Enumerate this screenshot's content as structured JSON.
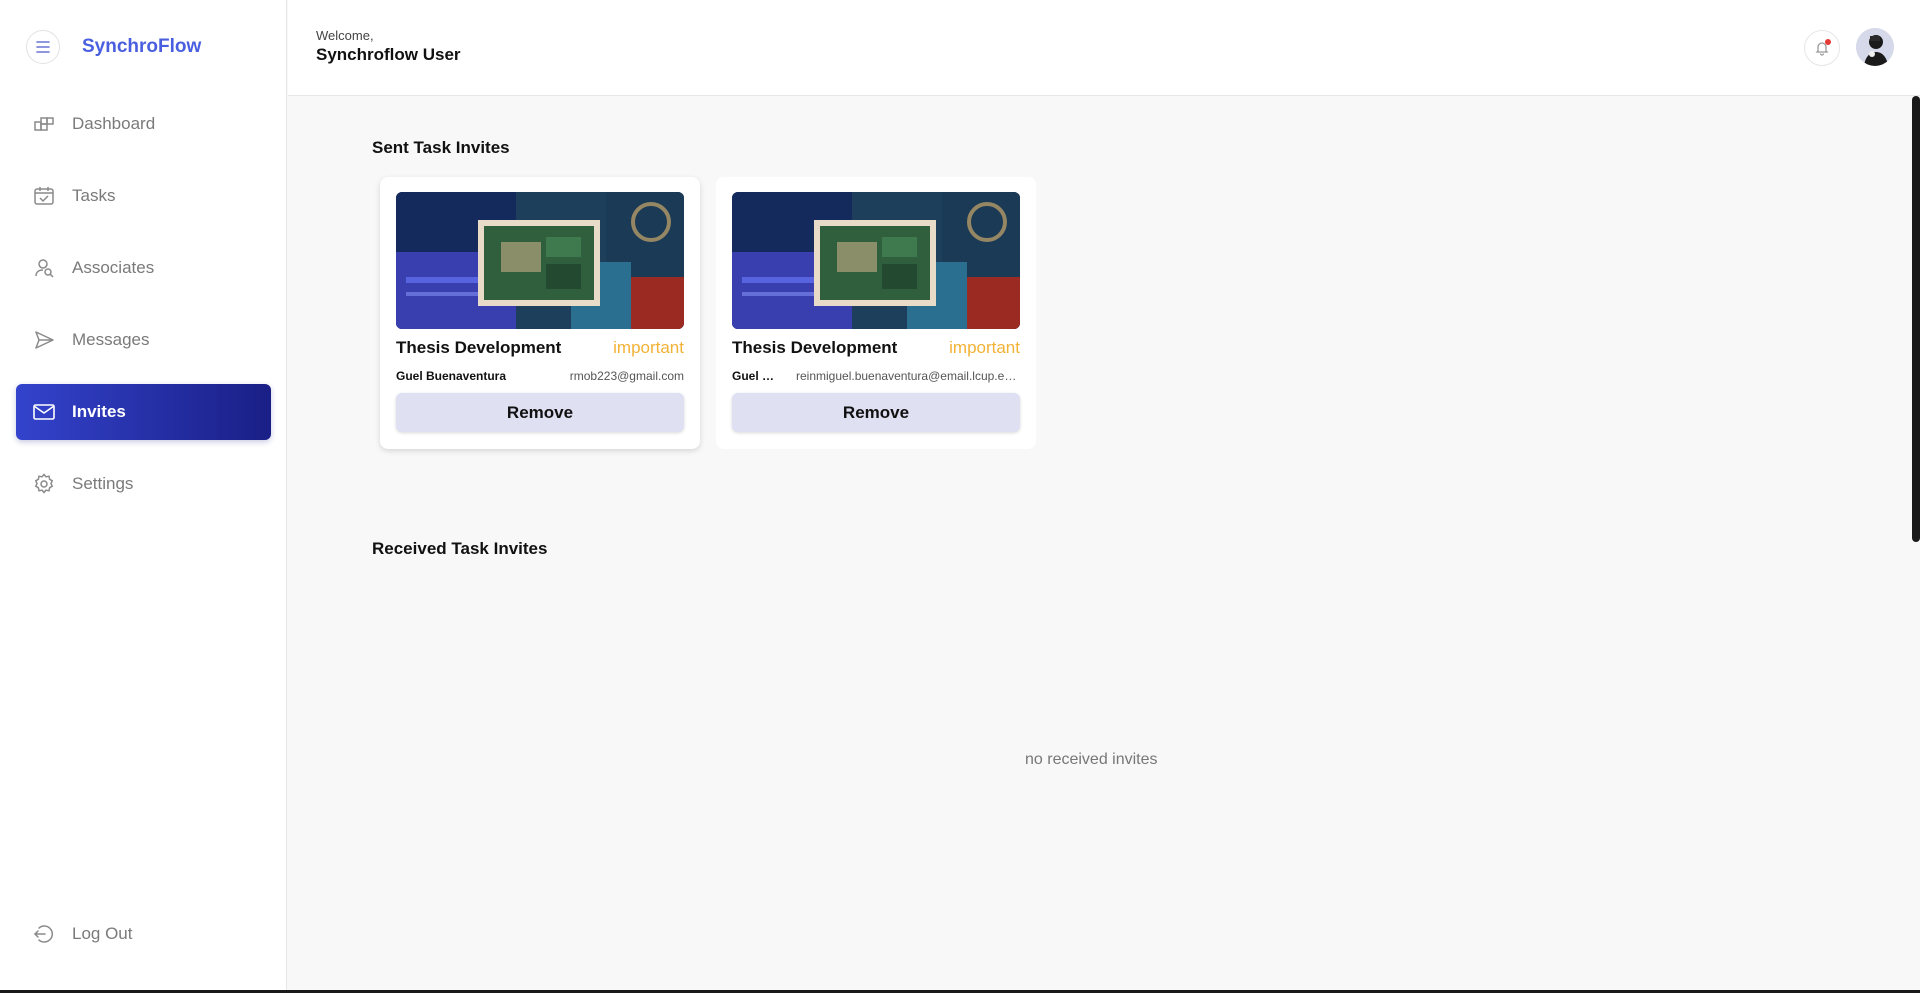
{
  "app": {
    "brand": "SynchroFlow"
  },
  "sidebar": {
    "items": [
      {
        "label": "Dashboard",
        "icon": "dashboard-icon"
      },
      {
        "label": "Tasks",
        "icon": "calendar-check-icon"
      },
      {
        "label": "Associates",
        "icon": "user-search-icon"
      },
      {
        "label": "Messages",
        "icon": "send-icon"
      },
      {
        "label": "Invites",
        "icon": "mail-icon",
        "active": true
      },
      {
        "label": "Settings",
        "icon": "gear-icon"
      }
    ],
    "logout": "Log Out"
  },
  "header": {
    "welcome": "Welcome,",
    "username": "Synchroflow User"
  },
  "main": {
    "sent_title": "Sent Task Invites",
    "received_title": "Received Task Invites",
    "sent": [
      {
        "title": "Thesis Development",
        "tag": "important",
        "name": "Guel Buenaventura",
        "email": "rmob223@gmail.com",
        "button": "Remove"
      },
      {
        "title": "Thesis Development",
        "tag": "important",
        "name": "Guel Buenaventura",
        "email": "reinmiguel.buenaventura@email.lcup.edu.ph",
        "button": "Remove"
      }
    ],
    "received_empty": "no received invites"
  },
  "colors": {
    "brand": "#4a5fe0",
    "active_start": "#3343cc",
    "active_end": "#1a1f86",
    "tag": "#f2b236",
    "button_bg": "#dfe0f2"
  }
}
